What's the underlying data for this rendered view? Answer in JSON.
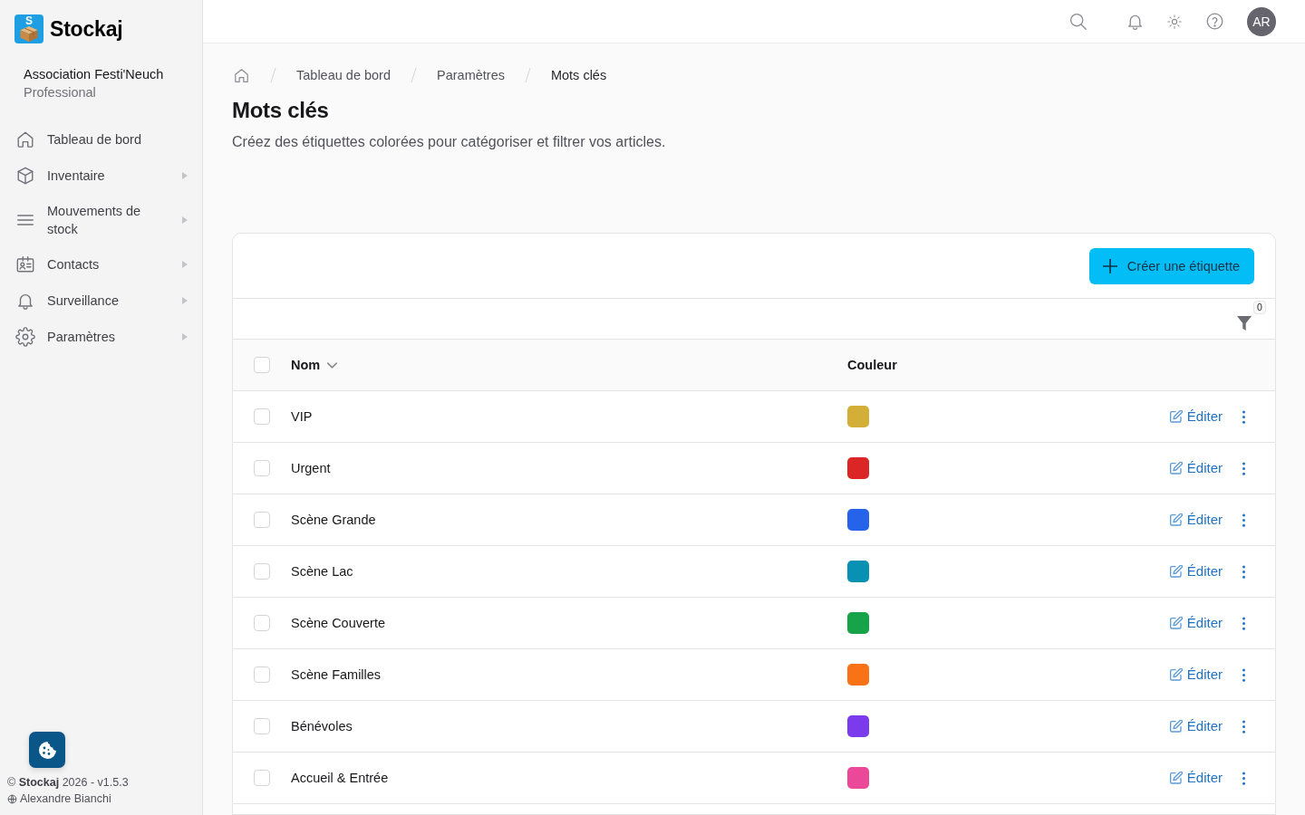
{
  "sidebar": {
    "logo_mark": "S",
    "app_name": "Stockaj",
    "organization": {
      "name": "Association Festi'Neuch",
      "plan": "Professional"
    },
    "items": [
      {
        "label": "Tableau de bord",
        "kind": "link",
        "selected": false
      },
      {
        "label": "Inventaire",
        "kind": "group",
        "selected": false
      },
      {
        "label": "Mouvements de stock",
        "kind": "group",
        "selected": false
      },
      {
        "label": "Contacts",
        "kind": "group",
        "selected": false
      },
      {
        "label": "Surveillance",
        "kind": "group",
        "selected": false
      },
      {
        "label": "Paramètres",
        "kind": "group",
        "selected": false
      }
    ],
    "footer": {
      "copyright": "© **Stockaj** 2026 - v1.5.3",
      "user": "Alexandre Bianchi"
    }
  },
  "top_bar": {
    "avatar_initials": "AR"
  },
  "breadcrumb": [
    {
      "label": "Tableau de bord",
      "current": false
    },
    {
      "label": "Paramètres",
      "current": false
    },
    {
      "label": "Mots clés",
      "current": true
    }
  ],
  "page": {
    "title": "Mots clés",
    "description": "Créez des étiquettes colorées pour catégoriser et filtrer vos articles."
  },
  "toolbar": {
    "create_button": "Créer une étiquette"
  },
  "filter": {
    "count": "0"
  },
  "table": {
    "select_all_checked": false,
    "columns": [
      {
        "label": "Nom",
        "sorted": true
      },
      {
        "label": "Couleur",
        "sorted": false
      }
    ],
    "rows": [
      {
        "name": "VIP",
        "color": "#d4af37",
        "checked": false,
        "action": "Éditer"
      },
      {
        "name": "Urgent",
        "color": "#dc2626",
        "checked": false,
        "action": "Éditer"
      },
      {
        "name": "Scène Grande",
        "color": "#2563eb",
        "checked": false,
        "action": "Éditer"
      },
      {
        "name": "Scène Lac",
        "color": "#0891b2",
        "checked": false,
        "action": "Éditer"
      },
      {
        "name": "Scène Couverte",
        "color": "#16a34a",
        "checked": false,
        "action": "Éditer"
      },
      {
        "name": "Scène Familles",
        "color": "#f97316",
        "checked": false,
        "action": "Éditer"
      },
      {
        "name": "Bénévoles",
        "color": "#7c3aed",
        "checked": false,
        "action": "Éditer"
      },
      {
        "name": "Accueil & Entrée",
        "color": "#ec4899",
        "checked": false,
        "action": "Éditer"
      }
    ]
  }
}
